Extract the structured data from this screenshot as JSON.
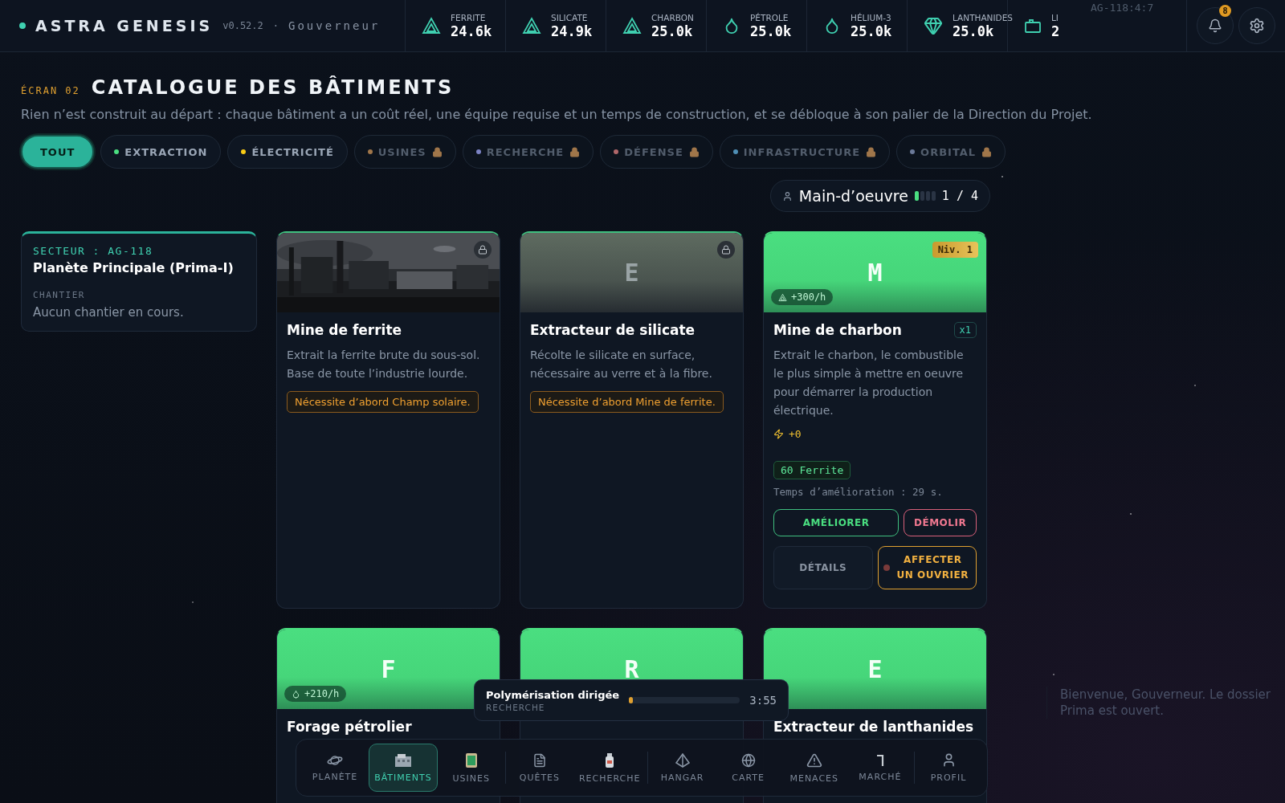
{
  "header": {
    "brand": "ASTRA GENESIS",
    "version": "v0.52.2",
    "separator": "·",
    "role": "Gouverneur",
    "coords": "AG-118:4:7"
  },
  "resources": [
    {
      "kind": "mineral",
      "label": "FERRITE",
      "value": "24.6k"
    },
    {
      "kind": "mineral",
      "label": "SILICATE",
      "value": "24.9k"
    },
    {
      "kind": "mineral",
      "label": "CHARBON",
      "value": "25.0k"
    },
    {
      "kind": "drop",
      "label": "PÉTROLE",
      "value": "25.0k"
    },
    {
      "kind": "drop",
      "label": "HÉLIUM-3",
      "value": "25.0k"
    },
    {
      "kind": "gem",
      "label": "LANTHANIDES",
      "value": "25.0k"
    },
    {
      "kind": "crate",
      "label": "LI",
      "value": "2"
    }
  ],
  "notifications": {
    "count": "8"
  },
  "page": {
    "screen": "ÉCRAN 02",
    "title": "CATALOGUE DES BÂTIMENTS",
    "subtitle": "Rien n’est construit au départ : chaque bâtiment a un coût réel, une équipe requise et un temps de construction, et se débloque à son palier de la Direction du Projet."
  },
  "filters": [
    {
      "label": "TOUT",
      "selected": true,
      "locked": false
    },
    {
      "label": "EXTRACTION",
      "selected": false,
      "locked": false,
      "color": "#4ade80"
    },
    {
      "label": "ÉLECTRICITÉ",
      "selected": false,
      "locked": false,
      "color": "#facc15"
    },
    {
      "label": "USINES",
      "selected": false,
      "locked": true,
      "color": "#a0764a"
    },
    {
      "label": "RECHERCHE",
      "selected": false,
      "locked": true,
      "color": "#7c83c4"
    },
    {
      "label": "DÉFENSE",
      "selected": false,
      "locked": true,
      "color": "#b0676a"
    },
    {
      "label": "INFRASTRUCTURE",
      "selected": false,
      "locked": true,
      "color": "#4f8fb5"
    },
    {
      "label": "ORBITAL",
      "selected": false,
      "locked": true,
      "color": "#6b7a99"
    }
  ],
  "workforce": {
    "label": "Main-d’oeuvre",
    "level": 0.25,
    "reading": "1 / 4"
  },
  "sector": {
    "code": "SECTEUR : AG-118",
    "planet": "Planète Principale (Prima-I)",
    "section_label": "CHANTIER",
    "status": "Aucun chantier en cours."
  },
  "buildings": [
    {
      "kind": "locked",
      "title": "Mine de ferrite",
      "description": "Extrait la ferrite brute du sous-sol. Base de toute l’industrie lourde.",
      "requirement": "Nécessite d’abord Champ solaire."
    },
    {
      "kind": "locked",
      "letter": "E",
      "title": "Extracteur de silicate",
      "description": "Récolte le silicate en surface, nécessaire au verre et à la fibre.",
      "requirement": "Nécessite d’abord Mine de ferrite."
    },
    {
      "kind": "built",
      "letter": "M",
      "level_badge": "Niv. 1",
      "rate": "+300/h",
      "title": "Mine de charbon",
      "count": "x1",
      "description": "Extrait le charbon, le combustible le plus simple à mettre en oeuvre pour démarrer la production électrique.",
      "power": "+0",
      "cost": "60 Ferrite",
      "time": "Temps d’amélioration : 29 s.",
      "actions": [
        {
          "kind": "upgrade",
          "label": "AMÉLIORER"
        },
        {
          "kind": "demolish",
          "label": "DÉMOLIR"
        },
        {
          "kind": "details",
          "label": "DÉTAILS"
        },
        {
          "kind": "assign",
          "label": "AFFECTER UN OUVRIER"
        }
      ]
    },
    {
      "kind": "preview",
      "letter": "F",
      "rate": "+210/h",
      "title": "Forage pétrolier"
    },
    {
      "kind": "preview",
      "letter": "R"
    },
    {
      "kind": "preview",
      "letter": "E",
      "title": "Extracteur de lanthanides"
    }
  ],
  "toast": {
    "title": "Polymérisation dirigée",
    "category": "RECHERCHE",
    "level": 0.02,
    "time": "3:55"
  },
  "welcome": {
    "text": "Bienvenue, Gouverneur. Le dossier Prima est ouvert."
  },
  "nav": [
    {
      "kind": "planet",
      "label": "PLANÈTE",
      "selected": false
    },
    {
      "kind": "building",
      "label": "BÂTIMENTS",
      "selected": true
    },
    {
      "kind": "factory",
      "label": "USINES",
      "selected": false,
      "divider": true
    },
    {
      "kind": "quest",
      "label": "QUÊTES",
      "selected": false
    },
    {
      "kind": "research",
      "label": "RECHERCHE",
      "selected": false,
      "divider": true
    },
    {
      "kind": "hangar",
      "label": "HANGAR",
      "selected": false
    },
    {
      "kind": "map",
      "label": "CARTE",
      "selected": false
    },
    {
      "kind": "threat",
      "label": "MENACES",
      "selected": false
    },
    {
      "kind": "market",
      "label": "MARCHÉ",
      "selected": false,
      "divider": true
    },
    {
      "kind": "profile",
      "label": "PROFIL",
      "selected": false
    }
  ]
}
